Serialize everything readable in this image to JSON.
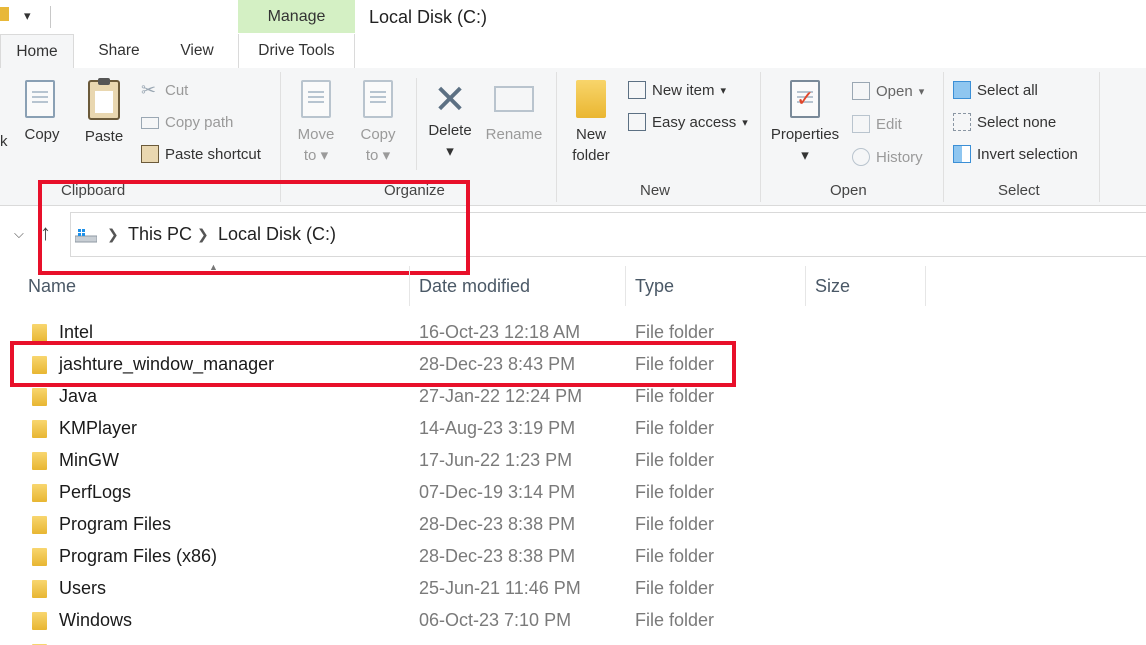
{
  "titlebar": {
    "manage_tab": "Manage",
    "window_title": "Local Disk (C:)"
  },
  "tabs": [
    {
      "label": "Home"
    },
    {
      "label": "Share"
    },
    {
      "label": "View"
    },
    {
      "label": "Drive Tools"
    }
  ],
  "ribbon": {
    "clipboard": {
      "partial_label": "k",
      "copy": "Copy",
      "paste": "Paste",
      "cut": "Cut",
      "copy_path": "Copy path",
      "paste_shortcut": "Paste shortcut",
      "group": "Clipboard"
    },
    "organize": {
      "move_to": "Move",
      "move_to_2": "to",
      "copy_to": "Copy",
      "copy_to_2": "to",
      "delete": "Delete",
      "rename": "Rename",
      "group": "Organize"
    },
    "new": {
      "new_item": "New item",
      "easy_access": "Easy access",
      "new_folder": "New",
      "new_folder_2": "folder",
      "group": "New"
    },
    "open": {
      "properties": "Properties",
      "open": "Open",
      "edit": "Edit",
      "history": "History",
      "group": "Open"
    },
    "select": {
      "select_all": "Select all",
      "select_none": "Select none",
      "invert_selection": "Invert selection",
      "group": "Select"
    }
  },
  "address": {
    "crumbs": [
      "This PC",
      "Local Disk (C:)"
    ]
  },
  "columns": {
    "name": "Name",
    "date": "Date modified",
    "type": "Type",
    "size": "Size"
  },
  "files": [
    {
      "name": "Intel",
      "date": "16-Oct-23 12:18 AM",
      "type": "File folder"
    },
    {
      "name": "jashture_window_manager",
      "date": "28-Dec-23 8:43 PM",
      "type": "File folder"
    },
    {
      "name": "Java",
      "date": "27-Jan-22 12:24 PM",
      "type": "File folder"
    },
    {
      "name": "KMPlayer",
      "date": "14-Aug-23 3:19 PM",
      "type": "File folder"
    },
    {
      "name": "MinGW",
      "date": "17-Jun-22 1:23 PM",
      "type": "File folder"
    },
    {
      "name": "PerfLogs",
      "date": "07-Dec-19 3:14 PM",
      "type": "File folder"
    },
    {
      "name": "Program Files",
      "date": "28-Dec-23 8:38 PM",
      "type": "File folder"
    },
    {
      "name": "Program Files (x86)",
      "date": "28-Dec-23 8:38 PM",
      "type": "File folder"
    },
    {
      "name": "Users",
      "date": "25-Jun-21 11:46 PM",
      "type": "File folder"
    },
    {
      "name": "Windows",
      "date": "06-Oct-23 7:10 PM",
      "type": "File folder"
    }
  ],
  "colors": {
    "manage_tab_bg": "#d4f0c4",
    "highlight_box": "#e8102a",
    "folder_yellow": "#eab631"
  }
}
